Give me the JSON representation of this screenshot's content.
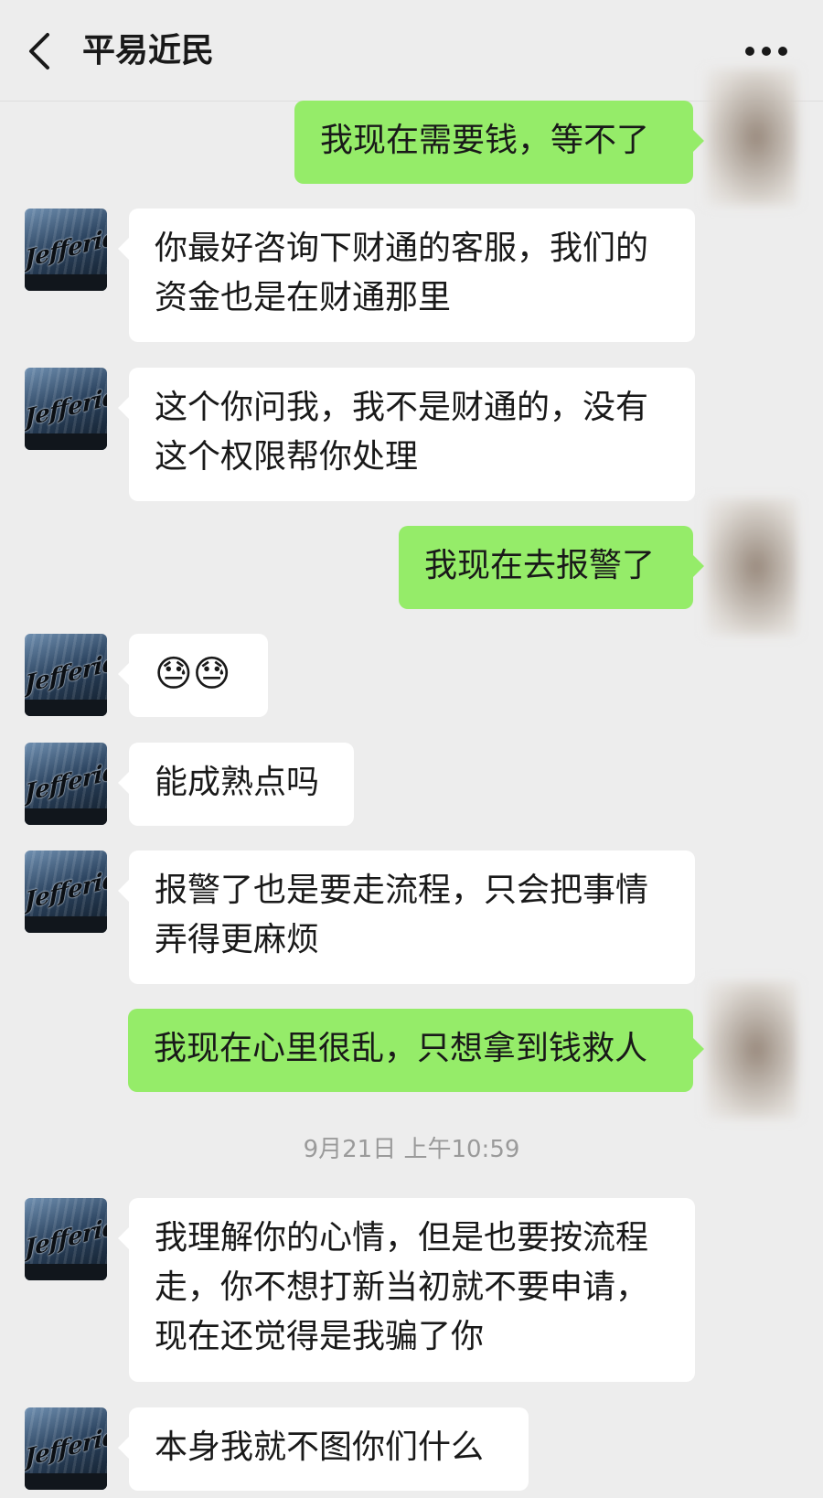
{
  "header": {
    "title": "平易近民",
    "back_icon": "chevron-left-icon",
    "more_icon": "more-dots-icon"
  },
  "avatar": {
    "other_sign_text": "Jefferies"
  },
  "messages": [
    {
      "side": "out",
      "text": "我现在需要钱，等不了"
    },
    {
      "side": "in",
      "text": "你最好咨询下财通的客服，我们的\n资金也是在财通那里"
    },
    {
      "side": "in",
      "text": "这个你问我，我不是财通的，没有\n这个权限帮你处理"
    },
    {
      "side": "out",
      "text": "我现在去报警了"
    },
    {
      "side": "in",
      "text": "😓😓"
    },
    {
      "side": "in",
      "text": "能成熟点吗"
    },
    {
      "side": "in",
      "text": "报警了也是要走流程，只会把事情\n弄得更麻烦"
    },
    {
      "side": "out",
      "text": "我现在心里很乱，只想拿到钱救人"
    },
    {
      "side": "in",
      "text": "我理解你的心情，但是也要按流程\n走，你不想打新当初就不要申请，\n现在还觉得是我骗了你"
    },
    {
      "side": "in",
      "text": "本身我就不图你们什么"
    }
  ],
  "timestamp": "9月21日 上午10:59",
  "colors": {
    "background": "#ededed",
    "outgoing_bubble": "#95ec69",
    "incoming_bubble": "#ffffff",
    "timestamp_text": "#9a9a9a"
  }
}
